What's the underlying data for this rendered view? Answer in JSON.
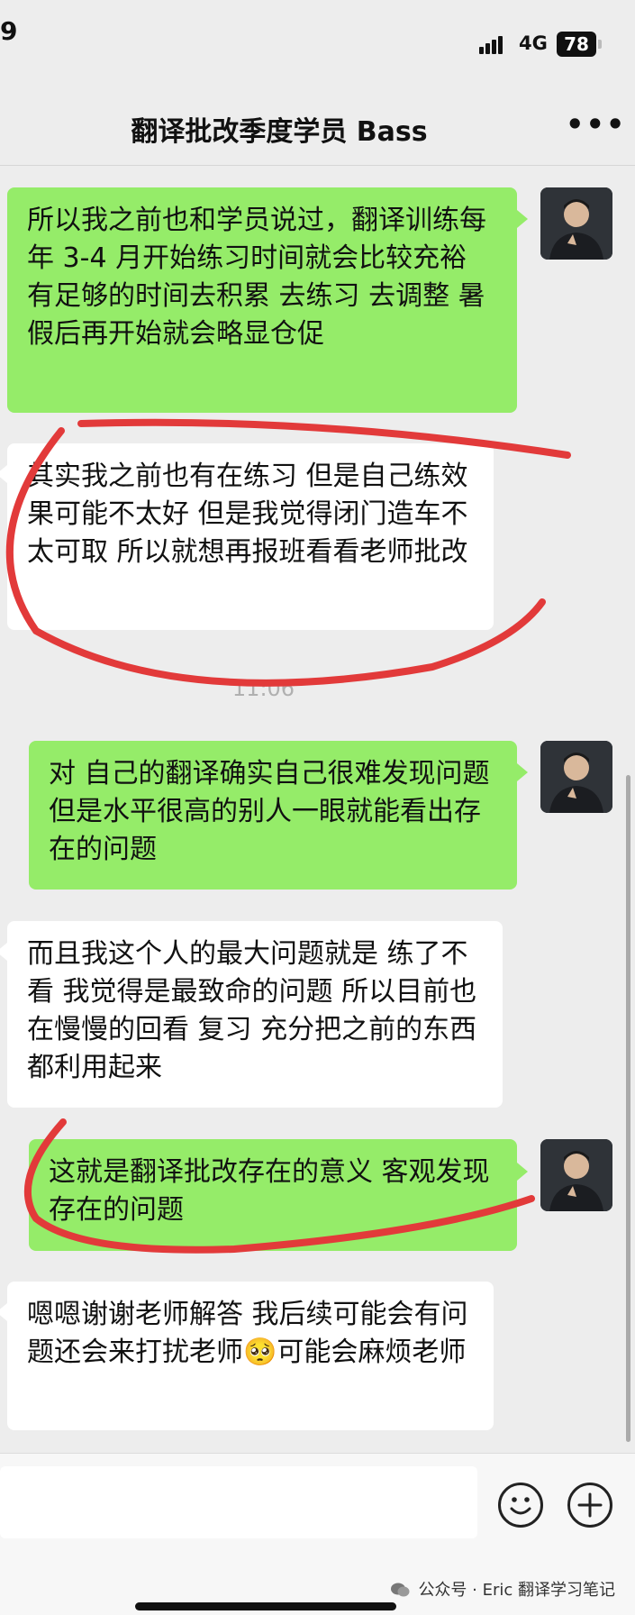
{
  "status": {
    "time": "9",
    "network": "4G",
    "battery": "78"
  },
  "nav": {
    "title": "翻译批改季度学员 Bass",
    "more": "•••"
  },
  "messages": [
    {
      "side": "right",
      "text": "所以我之前也和学员说过，翻译训练每年 3-4 月开始练习时间就会比较充裕 有足够的时间去积累 去练习 去调整 暑假后再开始就会略显仓促"
    },
    {
      "side": "left",
      "text": "其实我之前也有在练习 但是自己练效果可能不太好 但是我觉得闭门造车不太可取 所以就想再报班看看老师批改"
    },
    {
      "side": "right",
      "text": "对 自己的翻译确实自己很难发现问题 但是水平很高的别人一眼就能看出存在的问题"
    },
    {
      "side": "left",
      "text": "而且我这个人的最大问题就是 练了不看 我觉得是最致命的问题 所以目前也在慢慢的回看 复习 充分把之前的东西都利用起来"
    },
    {
      "side": "right",
      "text": "这就是翻译批改存在的意义 客观发现存在的问题"
    },
    {
      "side": "left",
      "text_before": "嗯嗯谢谢老师解答 我后续可能会有问题还会来打扰老师",
      "emoji": "🥺",
      "text_after": "可能会麻烦老师"
    }
  ],
  "timestamp": "11:06",
  "footer": {
    "credit": "公众号 · Eric 翻译学习笔记"
  },
  "colors": {
    "sent_bubble": "#95ec69",
    "received_bubble": "#ffffff",
    "background": "#ededed",
    "annotation": "#e23a3a"
  },
  "icons": [
    "emoji-icon",
    "plus-icon",
    "more-icon",
    "signal-icon",
    "battery-icon",
    "wechat-icon"
  ]
}
